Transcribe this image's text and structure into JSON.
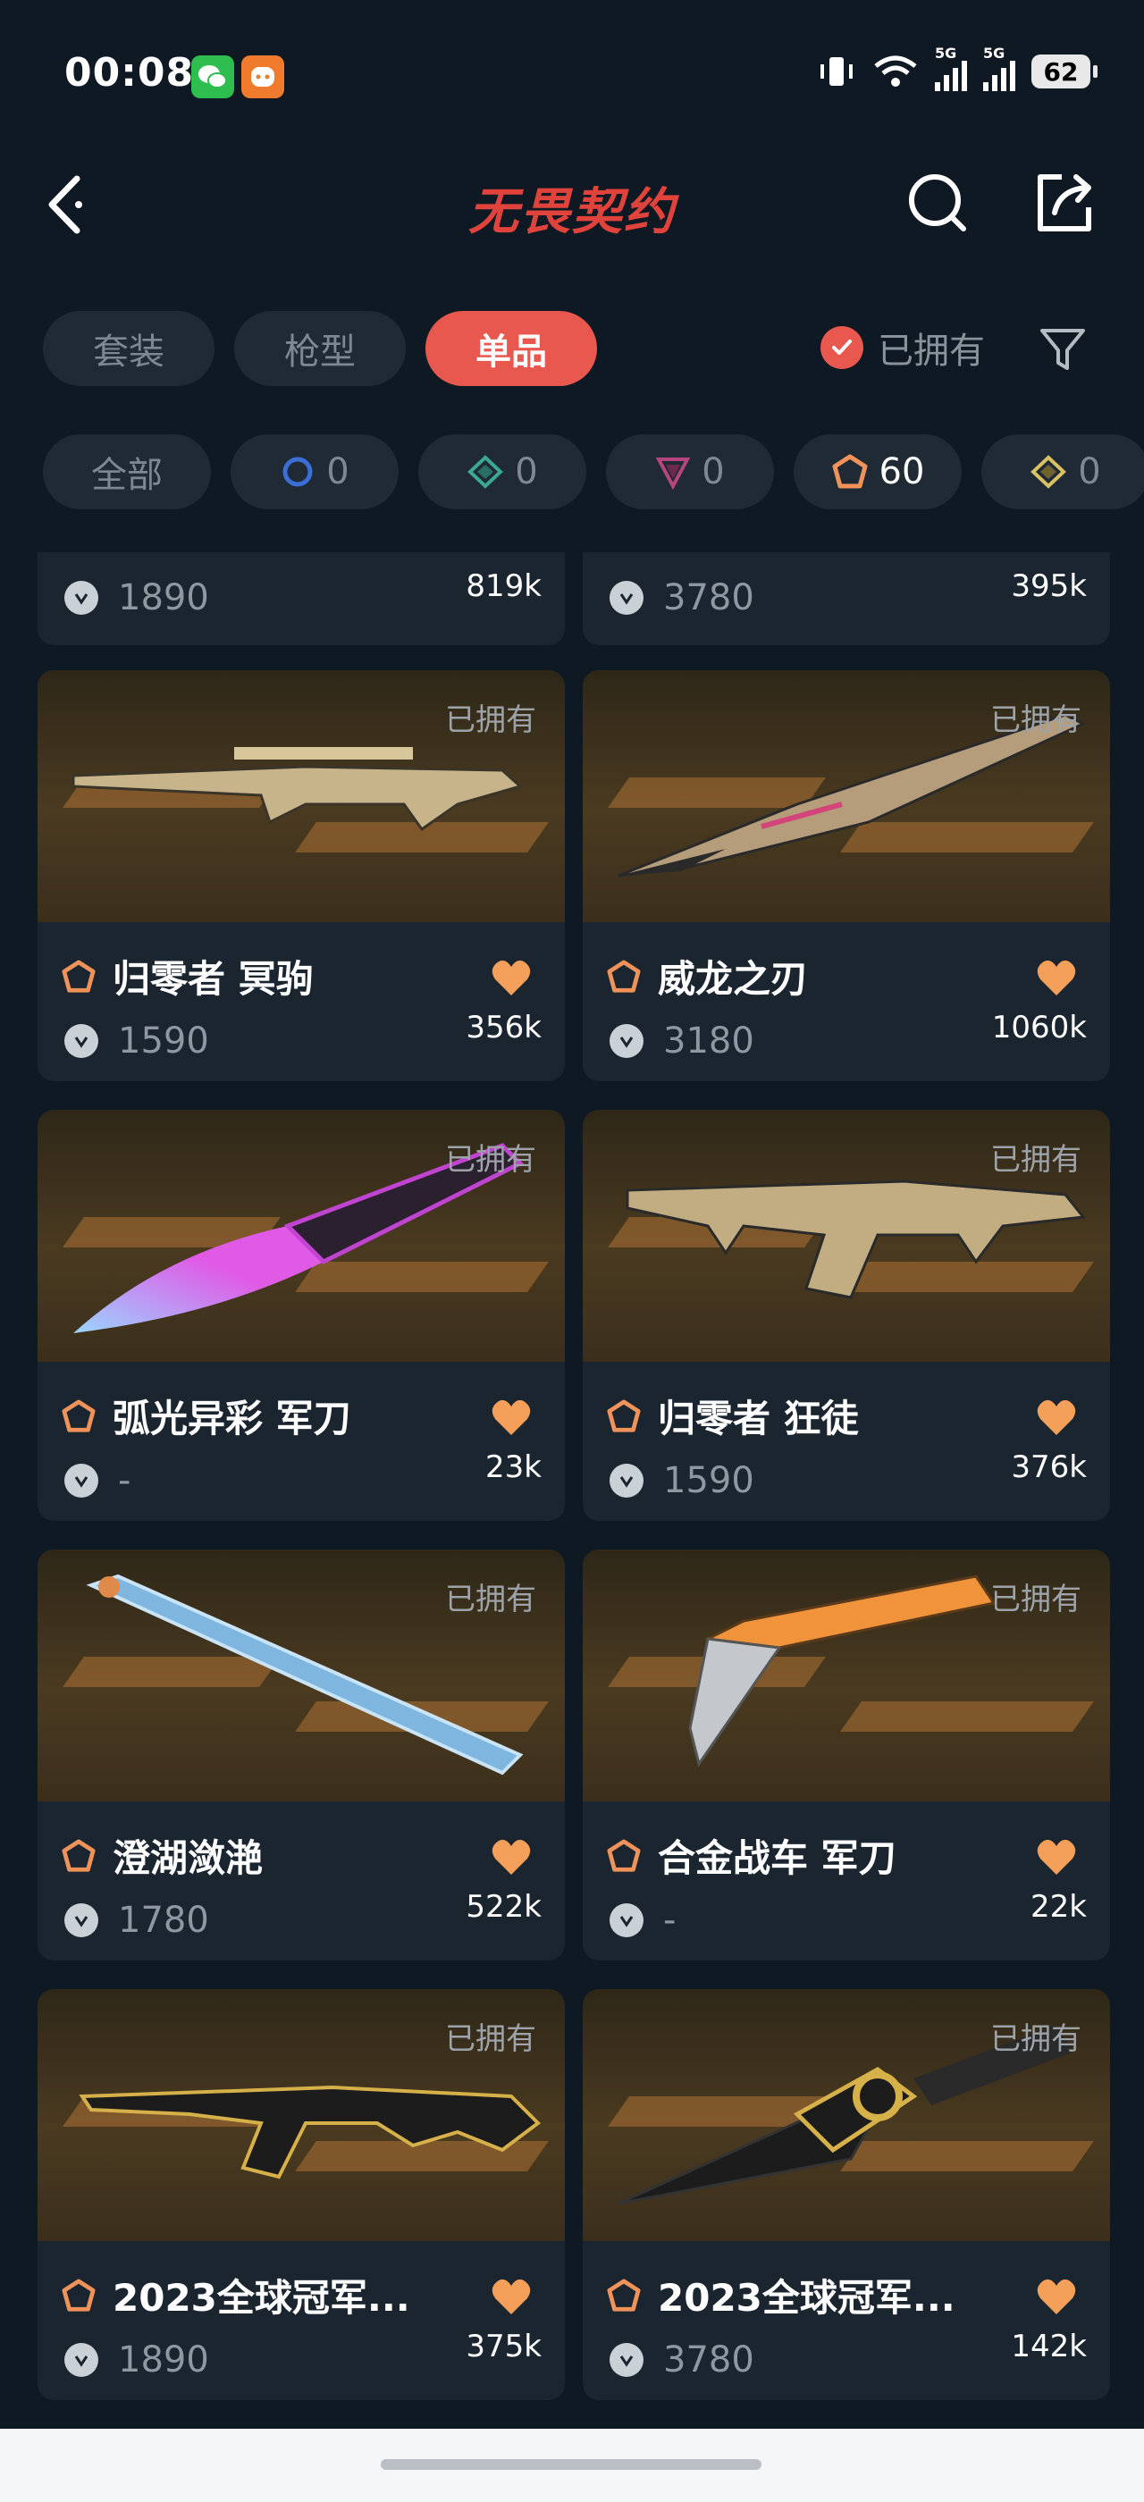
{
  "status": {
    "time": "00:08",
    "net1": "5G",
    "net2": "5G",
    "battery": "62"
  },
  "header": {
    "title": "无畏契约"
  },
  "tabs": [
    {
      "label": "套装"
    },
    {
      "label": "枪型"
    },
    {
      "label": "单品"
    }
  ],
  "owned_filter_label": "已拥有",
  "tiers": [
    {
      "label": "全部"
    },
    {
      "count": "0",
      "color": "#3b6fd6"
    },
    {
      "count": "0",
      "color": "#3aa894"
    },
    {
      "count": "0",
      "color": "#b8457d"
    },
    {
      "count": "60",
      "color": "#f0935a"
    },
    {
      "count": "0",
      "color": "#d8c264"
    }
  ],
  "partial_cards": [
    {
      "price": "1890",
      "likes": "819k"
    },
    {
      "price": "3780",
      "likes": "395k"
    }
  ],
  "cards": [
    {
      "name": "归零者 冥驹",
      "price": "1590",
      "likes": "356k",
      "owned": "已拥有"
    },
    {
      "name": "威龙之刃",
      "price": "3180",
      "likes": "1060k",
      "owned": "已拥有"
    },
    {
      "name": "弧光异彩 军刀",
      "price": "-",
      "likes": "23k",
      "owned": "已拥有"
    },
    {
      "name": "归零者 狂徒",
      "price": "1590",
      "likes": "376k",
      "owned": "已拥有"
    },
    {
      "name": "澄湖潋滟",
      "price": "1780",
      "likes": "522k",
      "owned": "已拥有"
    },
    {
      "name": "合金战车 军刀",
      "price": "-",
      "likes": "22k",
      "owned": "已拥有"
    },
    {
      "name": "2023全球冠军...",
      "price": "1890",
      "likes": "375k",
      "owned": "已拥有"
    },
    {
      "name": "2023全球冠军...",
      "price": "3780",
      "likes": "142k",
      "owned": "已拥有"
    }
  ],
  "colors": {
    "accent": "#e9584e",
    "heart": "#f5a05a",
    "tier_badge": "#f0935a"
  }
}
